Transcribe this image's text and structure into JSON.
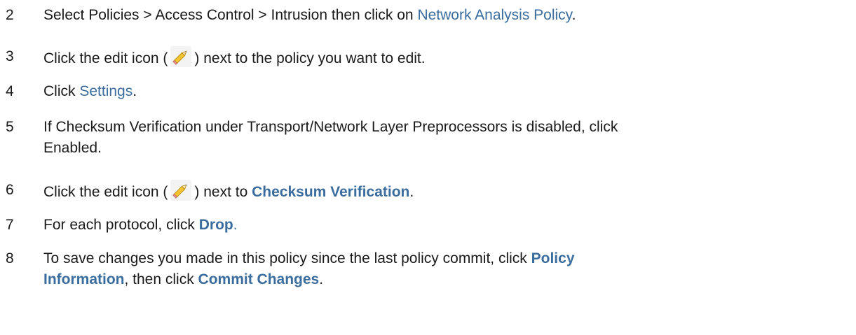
{
  "steps": [
    {
      "number": "2",
      "text_before": "Select Policies > Access Control > Intrusion then click on ",
      "link": "Network Analysis Policy",
      "text_after": "."
    },
    {
      "number": "3",
      "text_before": "Click the edit icon (",
      "icon": "pencil-edit-icon",
      "text_after": ") next to the policy you want to edit."
    },
    {
      "number": "4",
      "text_before": "Click ",
      "link": "Settings",
      "text_after": "."
    },
    {
      "number": "5",
      "line1": "If Checksum Verification under Transport/Network Layer Preprocessors is disabled, click",
      "line2": "Enabled."
    },
    {
      "number": "6",
      "text_before": "Click the edit icon (",
      "icon": "pencil-edit-icon",
      "text_mid": ") next to ",
      "bold_link": "Checksum Verification",
      "text_after": "."
    },
    {
      "number": "7",
      "text_before": "For each protocol, click ",
      "bold_link": "Drop",
      "text_after": "."
    },
    {
      "number": "8",
      "line1_before": "To save changes you made in this policy since the last policy commit, click ",
      "line1_bold": "Policy",
      "line2_bold": "Information",
      "line2_mid": ", then click ",
      "line2_bold2": "Commit Changes",
      "line2_after": "."
    }
  ],
  "colors": {
    "link": "#3a6d9e",
    "text": "#1a1a1a"
  }
}
